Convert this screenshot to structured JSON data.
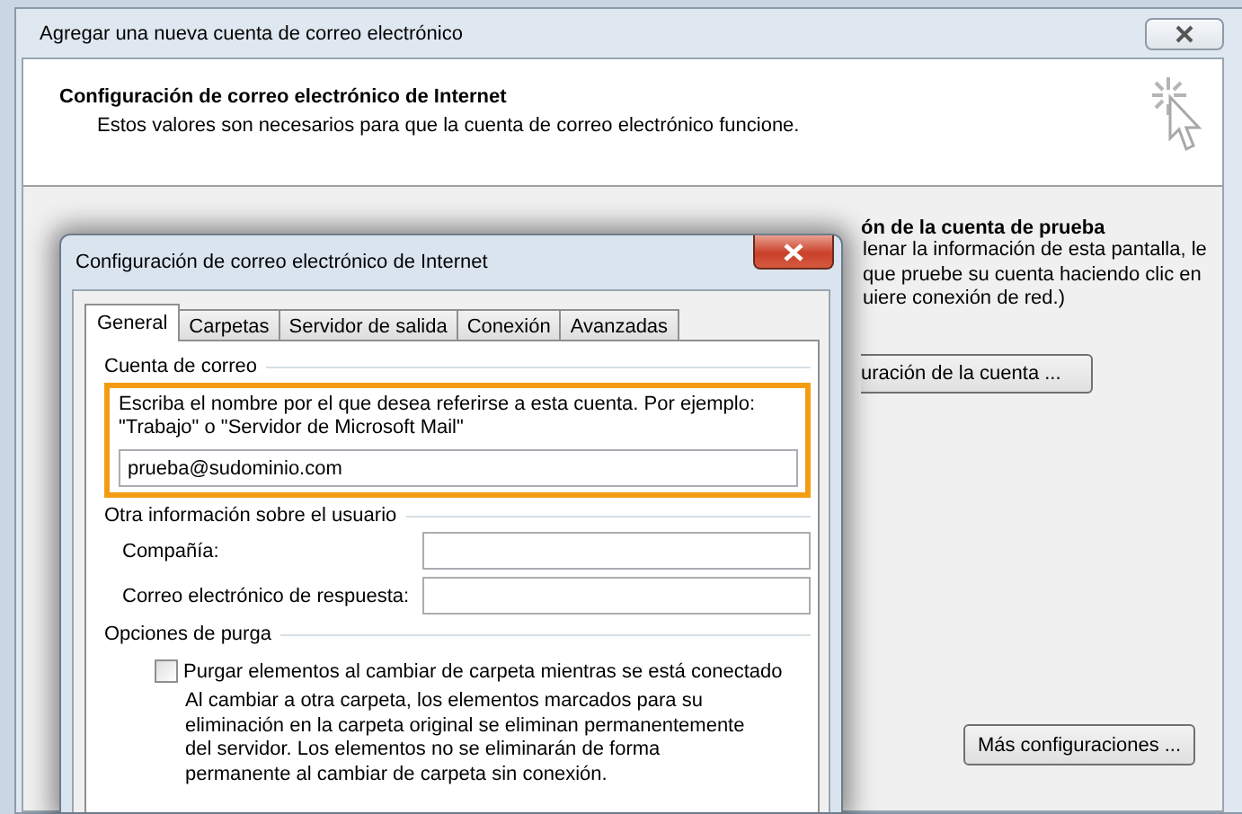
{
  "outer_window": {
    "title": "Agregar una nueva cuenta de correo electrónico",
    "header": {
      "title": "Configuración de correo electrónico de Internet",
      "subtitle": "Estos valores son necesarios para que la cuenta de correo electrónico funcione."
    },
    "test_section": {
      "heading": "ón de la cuenta de prueba",
      "lines": [
        "lenar la información de esta pantalla, le",
        "que pruebe su cuenta haciendo clic en",
        "uiere conexión de red.)"
      ],
      "button": "uración de la cuenta ..."
    },
    "more_settings_button": "Más configuraciones ..."
  },
  "dialog": {
    "title": "Configuración de correo electrónico de Internet",
    "tabs": [
      {
        "label": "General",
        "selected": true
      },
      {
        "label": "Carpetas",
        "selected": false
      },
      {
        "label": "Servidor de salida",
        "selected": false
      },
      {
        "label": "Conexión",
        "selected": false
      },
      {
        "label": "Avanzadas",
        "selected": false
      }
    ],
    "account": {
      "legend": "Cuenta de correo",
      "instructions": "Escriba el nombre por el que desea referirse a esta cuenta. Por ejemplo: \"Trabajo\" o \"Servidor de Microsoft Mail\"",
      "value": "prueba@sudominio.com",
      "highlighted": true
    },
    "user_info": {
      "legend": "Otra información sobre el usuario",
      "fields": [
        {
          "label": "Compañía:"
        },
        {
          "label": "Correo electrónico de respuesta:"
        }
      ]
    },
    "purge": {
      "legend": "Opciones de purga",
      "checkbox": {
        "label": "Purgar elementos al cambiar de carpeta mientras se está conectado",
        "checked": false
      },
      "description": "Al cambiar a otra carpeta, los elementos marcados para su eliminación en la carpeta original se eliminan permanentemente del servidor. Los elementos no se eliminarán de forma permanente al cambiar de carpeta sin conexión."
    }
  }
}
